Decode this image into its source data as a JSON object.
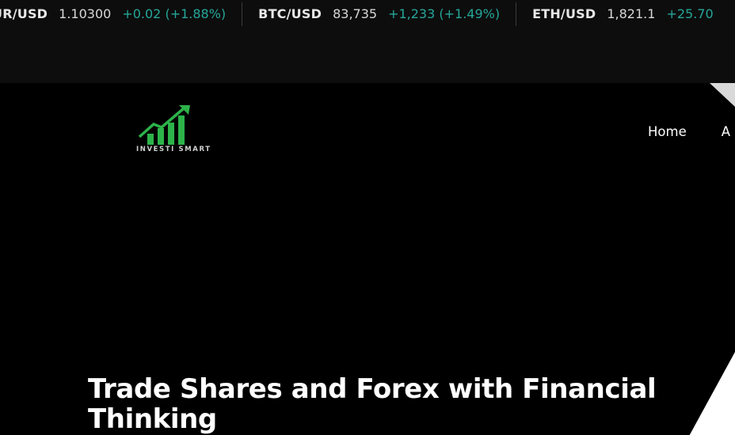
{
  "ticker": {
    "items": [
      {
        "symbol": "UR/USD",
        "price": "1.10300",
        "change": "+0.02 (+1.88%)"
      },
      {
        "symbol": "BTC/USD",
        "price": "83,735",
        "change": "+1,233 (+1.49%)"
      },
      {
        "symbol": "ETH/USD",
        "price": "1,821.1",
        "change": "+25.70"
      }
    ],
    "positive_color": "#26a69a"
  },
  "logo": {
    "text": "INVESTI SMART",
    "icon": "rising-bar-chart-arrow-icon",
    "color": "#2db34a"
  },
  "nav": {
    "items": [
      {
        "label": "Home"
      },
      {
        "label": "A"
      }
    ]
  },
  "hero": {
    "title": "Trade Shares and Forex with Financial Thinking"
  }
}
